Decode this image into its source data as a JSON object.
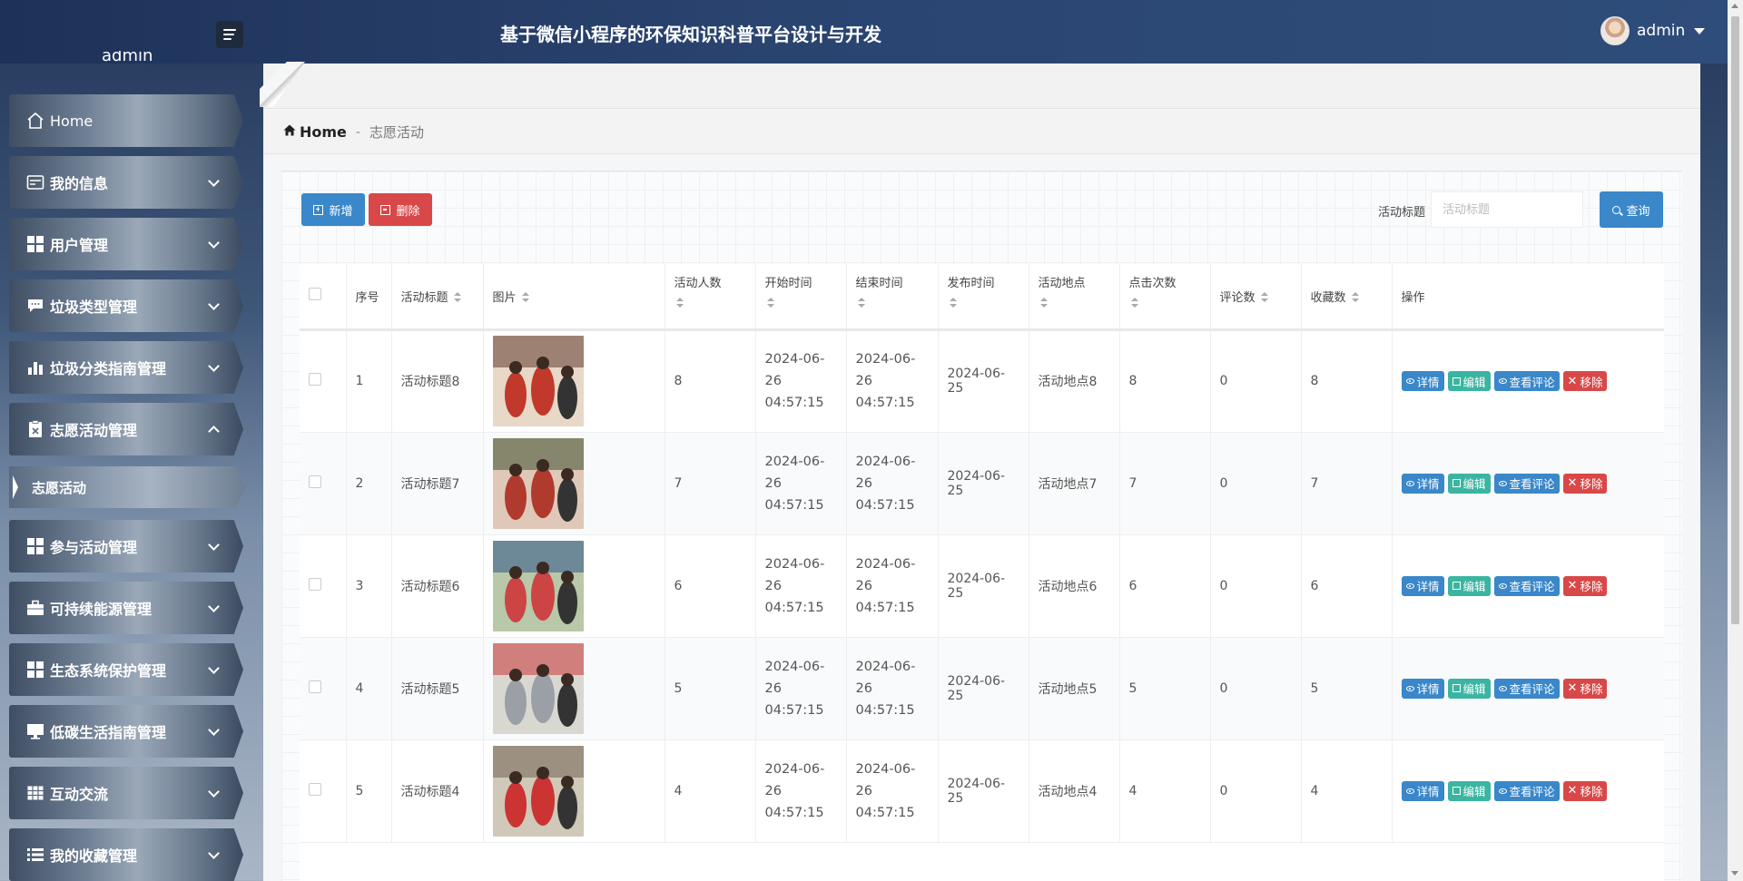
{
  "header": {
    "title": "基于微信小程序的环保知识科普平台设计与开发",
    "user": "admin"
  },
  "sidebar": {
    "user": "admin",
    "items": [
      {
        "label": "Home"
      },
      {
        "label": "我的信息"
      },
      {
        "label": "用户管理"
      },
      {
        "label": "垃圾类型管理"
      },
      {
        "label": "垃圾分类指南管理"
      },
      {
        "label": "志愿活动管理"
      },
      {
        "label": "参与活动管理"
      },
      {
        "label": "可持续能源管理"
      },
      {
        "label": "生态系统保护管理"
      },
      {
        "label": "低碳生活指南管理"
      },
      {
        "label": "互动交流"
      },
      {
        "label": "我的收藏管理"
      }
    ],
    "sub_item": "志愿活动"
  },
  "breadcrumb": {
    "home": "Home",
    "sep": "-",
    "current": "志愿活动"
  },
  "toolbar": {
    "add": "新增",
    "delete": "删除",
    "search_label": "活动标题",
    "search_placeholder": "活动标题",
    "search": "查询"
  },
  "table": {
    "headers": [
      "序号",
      "活动标题",
      "图片",
      "活动人数",
      "开始时间",
      "结束时间",
      "发布时间",
      "活动地点",
      "点击次数",
      "评论数",
      "收藏数",
      "操作"
    ],
    "actions": {
      "detail": "详情",
      "edit": "编辑",
      "comment": "查看评论",
      "remove": "移除"
    },
    "rows": [
      {
        "idx": "1",
        "title": "活动标题8",
        "people": "8",
        "start_date": "2024-06-26",
        "start_time": "04:57:15",
        "end_date": "2024-06-26",
        "end_time": "04:57:15",
        "publish": "2024-06-25",
        "place": "活动地点8",
        "clicks": "8",
        "comments": "0",
        "favs": "8"
      },
      {
        "idx": "2",
        "title": "活动标题7",
        "people": "7",
        "start_date": "2024-06-26",
        "start_time": "04:57:15",
        "end_date": "2024-06-26",
        "end_time": "04:57:15",
        "publish": "2024-06-25",
        "place": "活动地点7",
        "clicks": "7",
        "comments": "0",
        "favs": "7"
      },
      {
        "idx": "3",
        "title": "活动标题6",
        "people": "6",
        "start_date": "2024-06-26",
        "start_time": "04:57:15",
        "end_date": "2024-06-26",
        "end_time": "04:57:15",
        "publish": "2024-06-25",
        "place": "活动地点6",
        "clicks": "6",
        "comments": "0",
        "favs": "6"
      },
      {
        "idx": "4",
        "title": "活动标题5",
        "people": "5",
        "start_date": "2024-06-26",
        "start_time": "04:57:15",
        "end_date": "2024-06-26",
        "end_time": "04:57:15",
        "publish": "2024-06-25",
        "place": "活动地点5",
        "clicks": "5",
        "comments": "0",
        "favs": "5"
      },
      {
        "idx": "5",
        "title": "活动标题4",
        "people": "4",
        "start_date": "2024-06-26",
        "start_time": "04:57:15",
        "end_date": "2024-06-26",
        "end_time": "04:57:15",
        "publish": "2024-06-25",
        "place": "活动地点4",
        "clicks": "4",
        "comments": "0",
        "favs": "4"
      }
    ]
  },
  "colors": {
    "primary": "#3a87c9",
    "danger": "#d94848",
    "teal": "#3bb5a1",
    "header": "#2a4470"
  }
}
